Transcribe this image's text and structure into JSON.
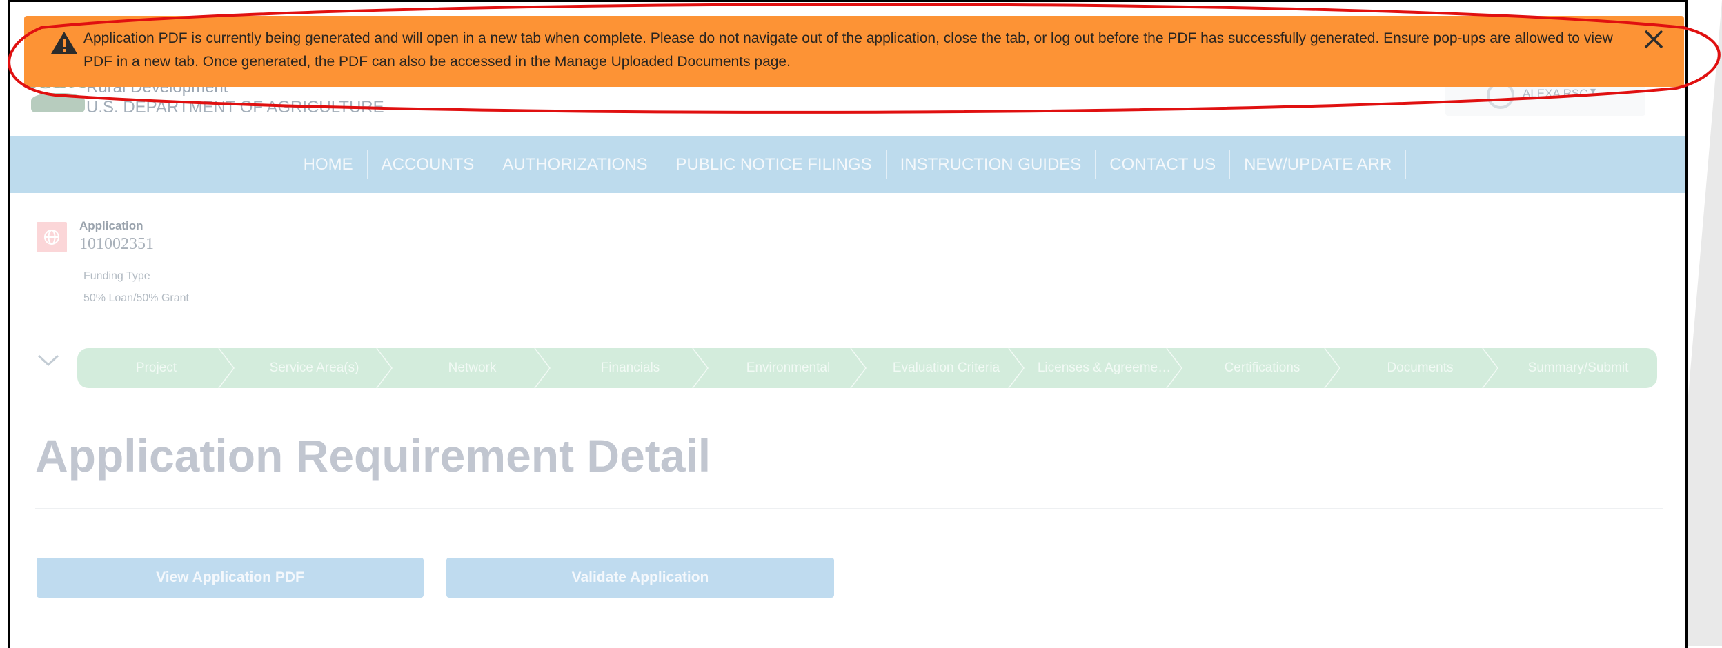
{
  "banner": {
    "message": "Application PDF is currently being generated and will open in a new tab when complete. Please do not navigate out of the application, close the tab, or log out before the PDF has successfully generated. Ensure pop-ups are allowed to view PDF in a new tab. Once generated, the PDF can also be accessed in the Manage Uploaded Documents page.",
    "icon": "warning-icon",
    "close_icon": "close-icon",
    "color": "#fd9335"
  },
  "header": {
    "logo_mark": "USDA",
    "agency_name": "Rural Development",
    "department": "U.S. DEPARTMENT OF AGRICULTURE",
    "user_name": "ALEXA RSC",
    "user_caret": "▾"
  },
  "nav": {
    "items": [
      "HOME",
      "ACCOUNTS",
      "AUTHORIZATIONS",
      "PUBLIC NOTICE FILINGS",
      "INSTRUCTION GUIDES",
      "CONTACT US",
      "NEW/UPDATE ARR"
    ]
  },
  "application": {
    "label": "Application",
    "number": "101002351",
    "funding_label": "Funding Type",
    "funding_value": "50% Loan/50% Grant"
  },
  "steps": {
    "collapse_icon": "chevron-down-icon",
    "items": [
      "Project",
      "Service Area(s)",
      "Network",
      "Financials",
      "Environmental",
      "Evaluation Criteria",
      "Licenses & Agreeme…",
      "Certifications",
      "Documents",
      "Summary/Submit"
    ]
  },
  "page": {
    "title": "Application Requirement Detail"
  },
  "actions": {
    "view_pdf": "View Application PDF",
    "validate": "Validate Application"
  }
}
